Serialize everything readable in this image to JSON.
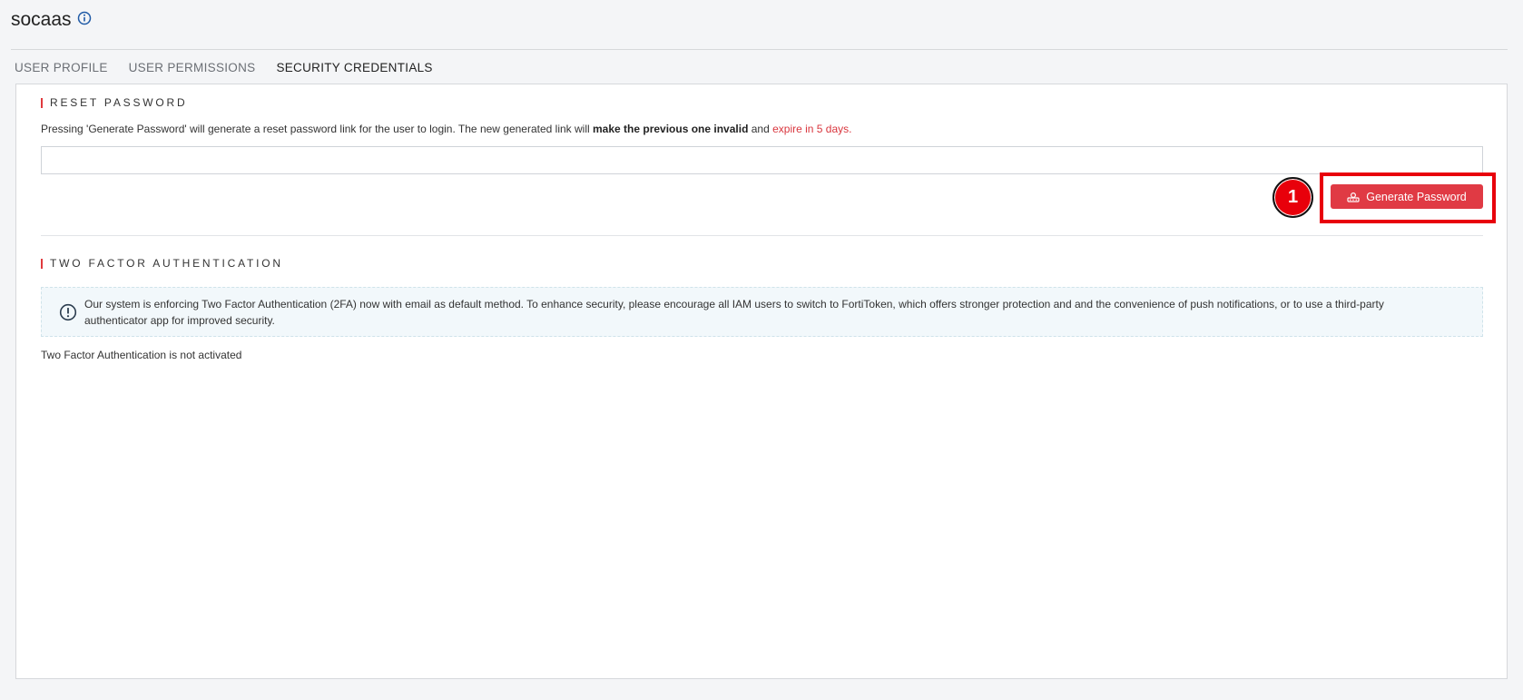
{
  "header": {
    "title": "socaas",
    "info_icon": "info-circle-icon"
  },
  "tabs": [
    {
      "label": "USER PROFILE",
      "active": false
    },
    {
      "label": "USER PERMISSIONS",
      "active": false
    },
    {
      "label": "SECURITY CREDENTIALS",
      "active": true
    }
  ],
  "reset_password": {
    "title": "RESET PASSWORD",
    "desc_prefix": "Pressing 'Generate Password' will generate a reset password link for the user to login. The new generated link will ",
    "desc_bold": "make the previous one invalid",
    "desc_mid": " and ",
    "desc_red": "expire in 5 days.",
    "link_value": "",
    "link_placeholder": "",
    "button_label": "Generate Password",
    "button_icon": "key-icon"
  },
  "annotation": {
    "step_number": "1",
    "highlight_color": "#e8000b"
  },
  "two_factor": {
    "title": "TWO FACTOR AUTHENTICATION",
    "notice_icon": "alert-circle-icon",
    "notice_text": "Our system is enforcing Two Factor Authentication (2FA) now with email as default method. To enhance security, please encourage all IAM users to switch to FortiToken, which offers stronger protection and and the convenience of push notifications, or to use a third-party authenticator app for improved security.",
    "status": "Two Factor Authentication is not activated"
  },
  "colors": {
    "accent": "#e03a3e",
    "button": "#e03a44",
    "link_red": "#d9363e"
  }
}
